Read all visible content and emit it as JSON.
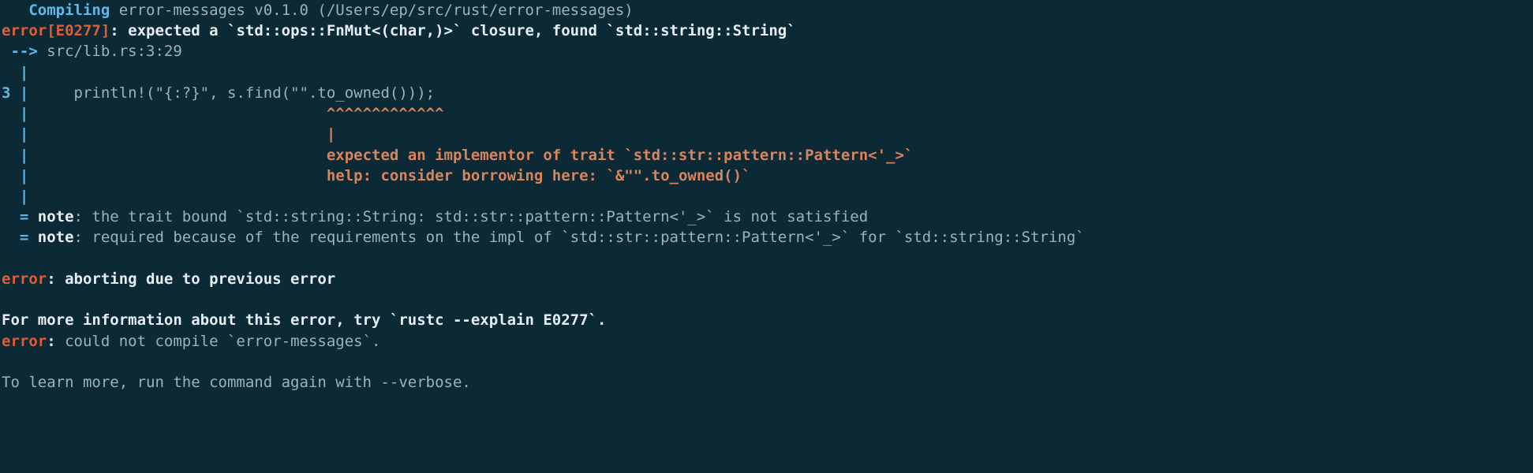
{
  "compiling": {
    "prefix_pad": "   ",
    "label": "Compiling",
    "rest": " error-messages v0.1.0 (/Users/ep/src/rust/error-messages)"
  },
  "err_head": {
    "code": "error[E0277]",
    "sep": ": ",
    "msg1": "expected a `std::ops::FnMut<(char,)>` closure, found `std::string::String`"
  },
  "loc": {
    "arrow": " --> ",
    "path": "src/lib.rs:3:29"
  },
  "gutter_blank": "  |",
  "code_line": {
    "num": "3 ",
    "pipe": "|",
    "code": "     println!(\"{:?}\", s.find(\"\".to_owned()));"
  },
  "caret_line": {
    "lead": "  |                                 ",
    "carets": "^^^^^^^^^^^^^"
  },
  "pipe_line": {
    "lead": "  |                                 ",
    "pipe": "|"
  },
  "expl_line": {
    "lead": "  |                                 ",
    "text": "expected an implementor of trait `std::str::pattern::Pattern<'_>`"
  },
  "help_line": {
    "lead": "  |                                 ",
    "help": "help",
    "rest": ": consider borrowing here: `&\"\".to_owned()`"
  },
  "note1": {
    "lead": "  = ",
    "label": "note",
    "rest": ": the trait bound `std::string::String: std::str::pattern::Pattern<'_>` is not satisfied"
  },
  "note2": {
    "lead": "  = ",
    "label": "note",
    "rest": ": required because of the requirements on the impl of `std::str::pattern::Pattern<'_>` for `std::string::String`"
  },
  "abort": {
    "label": "error",
    "rest": ": aborting due to previous error"
  },
  "more_info": "For more information about this error, try `rustc --explain E0277`.",
  "fail": {
    "label": "error",
    "sep": ": ",
    "text": "could not compile `error-messages`."
  },
  "learn_more": "To learn more, run the command again with --verbose."
}
